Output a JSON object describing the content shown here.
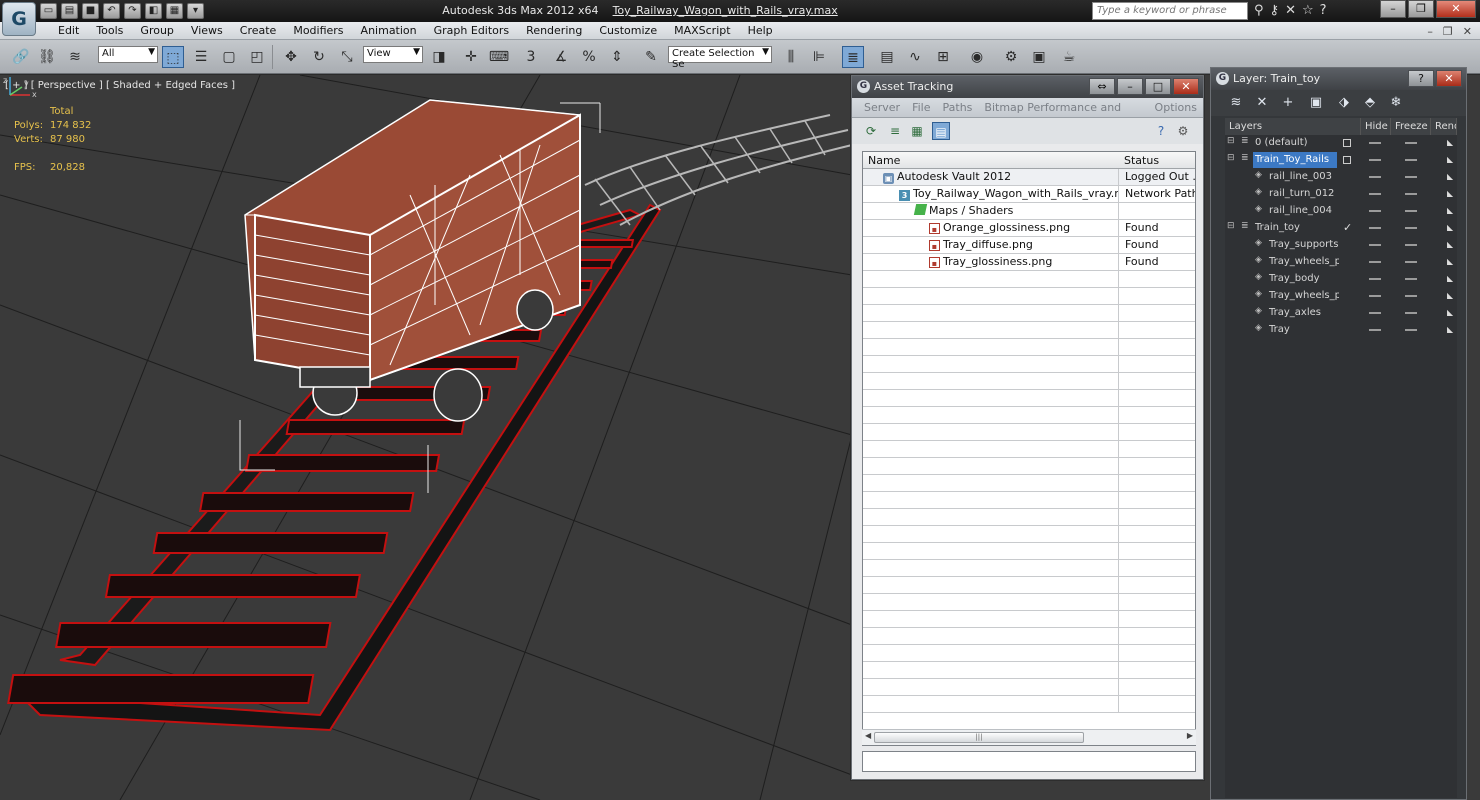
{
  "titlebar": {
    "app_title": "Autodesk 3ds Max 2012 x64",
    "file_name": "Toy_Railway_Wagon_with_Rails_vray.max",
    "search_placeholder": "Type a keyword or phrase",
    "logo_glyph": "G"
  },
  "menu": {
    "items": [
      "Edit",
      "Tools",
      "Group",
      "Views",
      "Create",
      "Modifiers",
      "Animation",
      "Graph Editors",
      "Rendering",
      "Customize",
      "MAXScript",
      "Help"
    ]
  },
  "toolbar": {
    "selection_filter": "All",
    "ref_coord": "View",
    "named_selection": "Create Selection Se"
  },
  "viewport": {
    "label": "[ + ] [ Perspective ] [ Shaded + Edged Faces ]",
    "stats": {
      "header": "Total",
      "polys_label": "Polys:",
      "polys_value": "174 832",
      "verts_label": "Verts:",
      "verts_value": "87 980",
      "fps_label": "FPS:",
      "fps_value": "20,828"
    },
    "axis": {
      "x": "x",
      "y": "y",
      "z": "z"
    }
  },
  "asset_tracking": {
    "title": "Asset Tracking",
    "menu": [
      "Server",
      "File",
      "Paths",
      "Bitmap Performance and Memory",
      "Options"
    ],
    "columns": {
      "name": "Name",
      "status": "Status"
    },
    "rows": [
      {
        "name": "Autodesk Vault 2012",
        "status": "Logged Out ...",
        "icon": "vault-icon"
      },
      {
        "name": "Toy_Railway_Wagon_with_Rails_vray.max",
        "status": "Network Path",
        "icon": "max-file-icon"
      },
      {
        "name": "Maps / Shaders",
        "status": "",
        "icon": "maps-icon"
      },
      {
        "name": "Orange_glossiness.png",
        "status": "Found",
        "icon": "image-icon"
      },
      {
        "name": "Tray_diffuse.png",
        "status": "Found",
        "icon": "image-icon"
      },
      {
        "name": "Tray_glossiness.png",
        "status": "Found",
        "icon": "image-icon"
      }
    ]
  },
  "layer_window": {
    "title": "Layer: Train_toy",
    "columns": {
      "layers": "Layers",
      "hide": "Hide",
      "freeze": "Freeze",
      "render": "Rende"
    },
    "rows": [
      {
        "name": "0 (default)",
        "indent": 0,
        "selected": false,
        "active": false
      },
      {
        "name": "Train_Toy_Rails",
        "indent": 0,
        "selected": true,
        "active": false
      },
      {
        "name": "rail_line_003",
        "indent": 1,
        "selected": false,
        "active": false
      },
      {
        "name": "rail_turn_012",
        "indent": 1,
        "selected": false,
        "active": false
      },
      {
        "name": "rail_line_004",
        "indent": 1,
        "selected": false,
        "active": false
      },
      {
        "name": "Train_toy",
        "indent": 0,
        "selected": false,
        "active": true
      },
      {
        "name": "Tray_supports",
        "indent": 1,
        "selected": false,
        "active": false
      },
      {
        "name": "Tray_wheels_pa",
        "indent": 1,
        "selected": false,
        "active": false
      },
      {
        "name": "Tray_body",
        "indent": 1,
        "selected": false,
        "active": false
      },
      {
        "name": "Tray_wheels_pa",
        "indent": 1,
        "selected": false,
        "active": false
      },
      {
        "name": "Tray_axles",
        "indent": 1,
        "selected": false,
        "active": false
      },
      {
        "name": "Tray",
        "indent": 1,
        "selected": false,
        "active": false
      }
    ]
  },
  "colors": {
    "viewport_bg": "#3a3a3a",
    "wireframe_red": "#c41010",
    "wagon_body": "#9a4a35",
    "selection_blue": "#3c79c4",
    "stats_yellow": "#e7c24c"
  }
}
